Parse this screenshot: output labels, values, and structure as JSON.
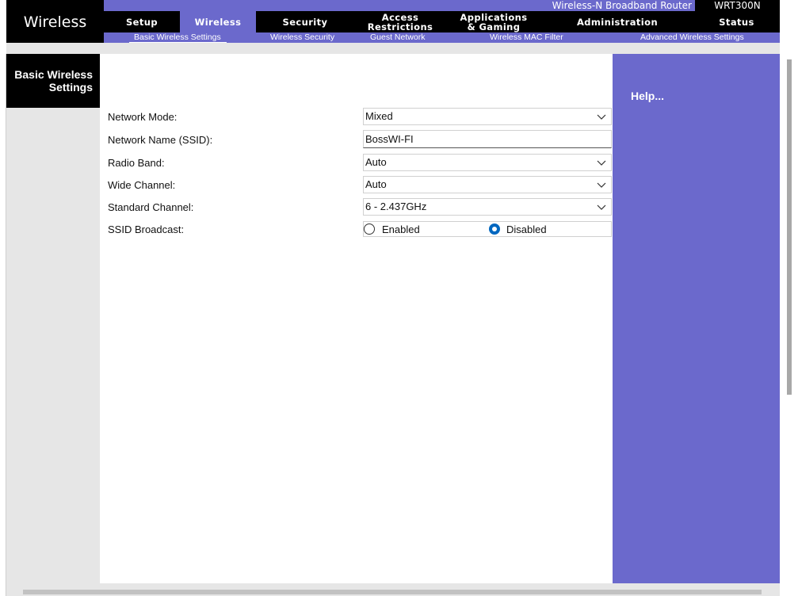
{
  "header": {
    "page_title": "Wireless",
    "product_name": "Wireless-N Broadband Router",
    "model": "WRT300N",
    "tabs": [
      {
        "label": "Setup"
      },
      {
        "label": "Wireless"
      },
      {
        "label": "Security"
      },
      {
        "label": "Access Restrictions"
      },
      {
        "label": "Applications & Gaming"
      },
      {
        "label": "Administration"
      },
      {
        "label": "Status"
      }
    ],
    "active_tab": "Wireless",
    "subtabs": [
      {
        "label": "Basic Wireless Settings"
      },
      {
        "label": "Wireless Security"
      },
      {
        "label": "Guest Network"
      },
      {
        "label": "Wireless MAC Filter"
      },
      {
        "label": "Advanced Wireless Settings"
      }
    ],
    "active_subtab": "Basic Wireless Settings"
  },
  "section": {
    "title": "Basic Wireless Settings"
  },
  "form": {
    "network_mode": {
      "label": "Network Mode:",
      "value": "Mixed"
    },
    "ssid": {
      "label": "Network Name (SSID):",
      "value": "BossWI-FI"
    },
    "radio_band": {
      "label": "Radio Band:",
      "value": "Auto"
    },
    "wide_channel": {
      "label": "Wide Channel:",
      "value": "Auto"
    },
    "standard_channel": {
      "label": "Standard Channel:",
      "value": "6 - 2.437GHz"
    },
    "ssid_broadcast": {
      "label": "SSID Broadcast:",
      "options": [
        {
          "label": "Enabled",
          "selected": false
        },
        {
          "label": "Disabled",
          "selected": true
        }
      ]
    }
  },
  "help": {
    "link_label": "Help..."
  },
  "colors": {
    "accent_purple": "#6b69cc",
    "header_black": "#000000",
    "panel_gray": "#e6e6e6",
    "radio_selected": "#0067c0"
  },
  "icons": {
    "dropdown": "chevron-down-icon",
    "radio_on": "radio-selected-icon",
    "radio_off": "radio-unselected-icon"
  }
}
